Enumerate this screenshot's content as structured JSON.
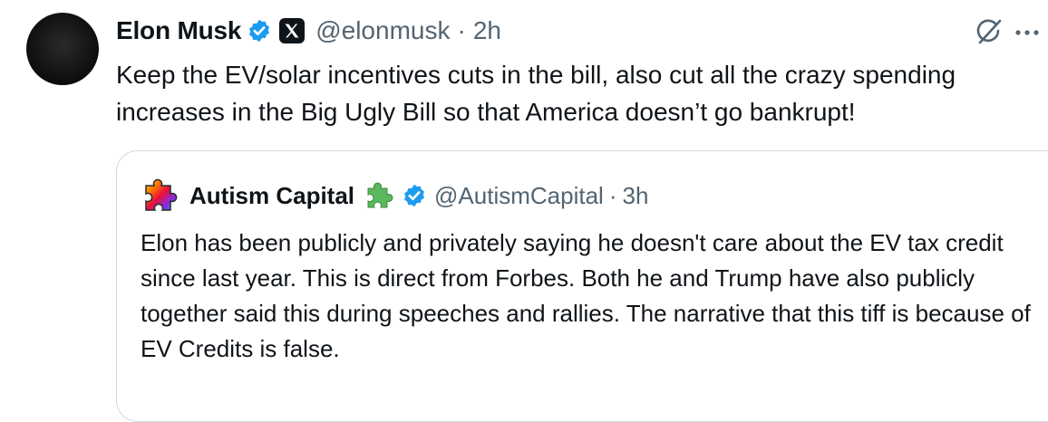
{
  "tweet": {
    "author_name": "Elon Musk",
    "handle": "@elonmusk",
    "separator": "·",
    "time": "2h",
    "verified_icon": "verified-badge-icon",
    "affiliate_icon": "x-logo-icon",
    "text": "Keep the EV/solar incentives cuts in the bill, also cut all the crazy spending increases in the Big Ugly Bill so that America doesn’t go bankrupt!",
    "action_icons": [
      "grok-icon",
      "more-icon"
    ]
  },
  "quote": {
    "author_name": "Autism Capital",
    "emoji_icon": "puzzle-piece-icon",
    "verified_icon": "verified-badge-icon",
    "handle": "@AutismCapital",
    "separator": "·",
    "time": "3h",
    "text": "Elon has been publicly and privately saying he doesn't care about the EV tax credit since last year. This is direct from Forbes. Both he and Trump have also publicly together said this during speeches and rallies. The narrative that this tiff is because of EV Credits is false."
  },
  "colors": {
    "text_primary": "#0f1419",
    "text_secondary": "#536471",
    "verified_blue": "#1d9bf0",
    "border": "#cfd9de",
    "puzzle_green": "#5cb85c"
  }
}
